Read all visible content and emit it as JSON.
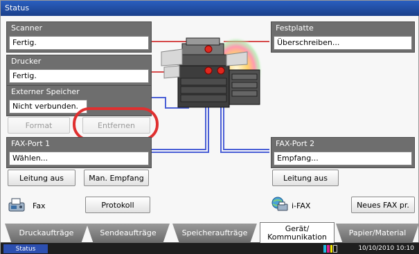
{
  "title_bar": {
    "title": "Status"
  },
  "panels": {
    "scanner": {
      "title": "Scanner",
      "value": "Fertig."
    },
    "drucker": {
      "title": "Drucker",
      "value": "Fertig."
    },
    "externer_speicher": {
      "title": "Externer Speicher",
      "value": "Nicht verbunden."
    },
    "festplatte": {
      "title": "Festplatte",
      "value": "Überschreiben..."
    },
    "fax_port_1": {
      "title": "FAX-Port 1",
      "value": "Wählen..."
    },
    "fax_port_2": {
      "title": "FAX-Port 2",
      "value": "Empfang..."
    }
  },
  "buttons": {
    "format": "Format",
    "entfernen": "Entfernen",
    "leitung_aus_1": "Leitung aus",
    "man_empfang": "Man. Empfang",
    "leitung_aus_2": "Leitung aus",
    "protokoll": "Protokoll",
    "neues_fax": "Neues FAX pr."
  },
  "fax_labels": {
    "fax": "Fax",
    "ifax": "i-FAX"
  },
  "tabs": [
    {
      "label": "Druckaufträge"
    },
    {
      "label": "Sendeaufträge"
    },
    {
      "label": "Speicheraufträge"
    },
    {
      "label": "Gerät/ Kommunikation"
    },
    {
      "label": "Papier/Material"
    }
  ],
  "status_bar": {
    "status_label": "Status",
    "datetime": "10/10/2010  10:10"
  },
  "colors": {
    "title_blue": "#1f4ea8",
    "panel_grey": "#6e6e6e",
    "highlight_red": "#e03030",
    "line_blue": "#4a5fd6",
    "line_red": "#d64a4a"
  }
}
